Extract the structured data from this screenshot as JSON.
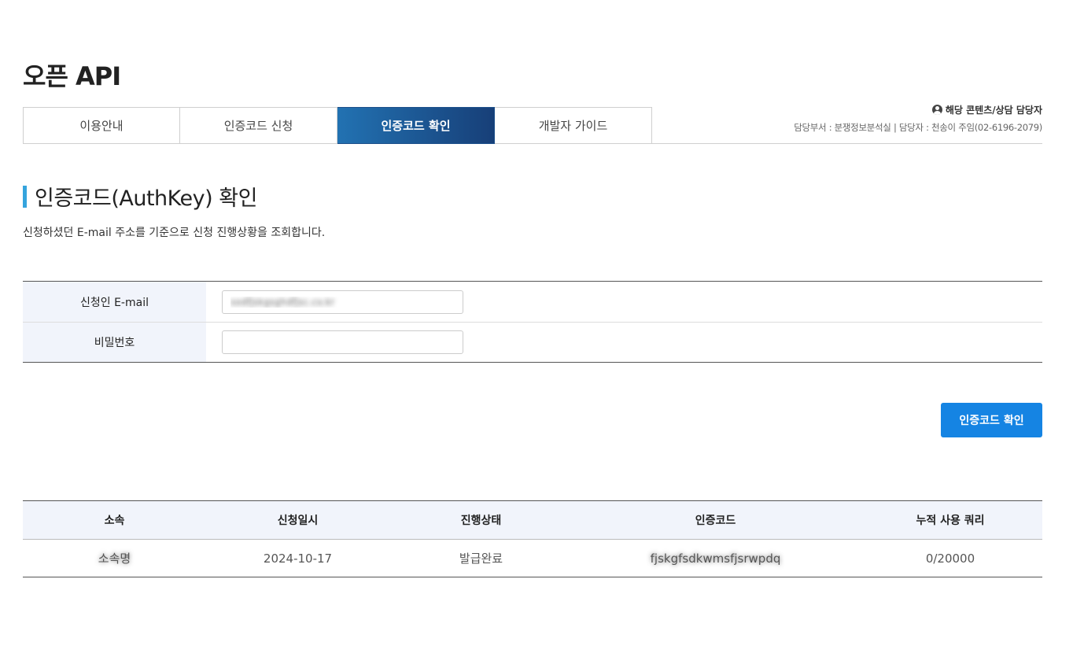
{
  "page": {
    "title": "오픈 API"
  },
  "tabs": [
    {
      "label": "이용안내"
    },
    {
      "label": "인증코드 신청"
    },
    {
      "label": "인증코드 확인",
      "active": true
    },
    {
      "label": "개발자 가이드"
    }
  ],
  "contact": {
    "title": "해당 콘텐츠/상담 담당자",
    "info": "담당부서 : 분쟁정보분석실 | 담당자 : 천송이 주임(02-6196-2079)"
  },
  "section": {
    "title": "인증코드(AuthKey) 확인",
    "description": "신청하셨던 E-mail 주소를 기준으로 신청 진행상황을 조회합니다."
  },
  "form": {
    "email_label": "신청인 E-mail",
    "email_value": "sodfjskgsghdfjsc.co.kr",
    "password_label": "비밀번호",
    "password_value": ""
  },
  "confirm_button": {
    "label": "인증코드 확인"
  },
  "results": {
    "headers": [
      "소속",
      "신청일시",
      "진행상태",
      "인증코드",
      "누적 사용 쿼리"
    ],
    "rows": [
      {
        "affiliation": "소속명",
        "date": "2024-10-17",
        "status": "발급완료",
        "authkey": "fjskgfsdkwmsfjsrwpdq",
        "usage": "0/20000"
      }
    ]
  },
  "colors": {
    "accent_bar": "#35a4dd",
    "active_tab_start": "#2272b2",
    "active_tab_end": "#173f78",
    "button": "#1584e3",
    "header_bg": "#f1f4fb"
  }
}
